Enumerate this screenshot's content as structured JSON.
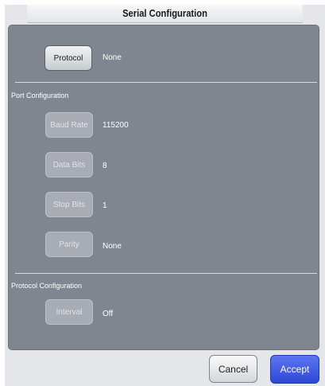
{
  "window": {
    "title": "Serial Configuration"
  },
  "protocol": {
    "button_label": "Protocol",
    "value": "None"
  },
  "port_configuration": {
    "heading": "Port Configuration",
    "baud_rate": {
      "label": "Baud Rate",
      "value": "115200"
    },
    "data_bits": {
      "label": "Data Bits",
      "value": "8"
    },
    "stop_bits": {
      "label": "Stop Bits",
      "value": "1"
    },
    "parity": {
      "label": "Parity",
      "value": "None"
    }
  },
  "protocol_configuration": {
    "heading": "Protocol Configuration",
    "interval": {
      "label": "Interval",
      "value": "Off"
    }
  },
  "footer": {
    "cancel_label": "Cancel",
    "accept_label": "Accept"
  },
  "colors": {
    "panel": "#80868f",
    "accent": "#3550e0"
  }
}
